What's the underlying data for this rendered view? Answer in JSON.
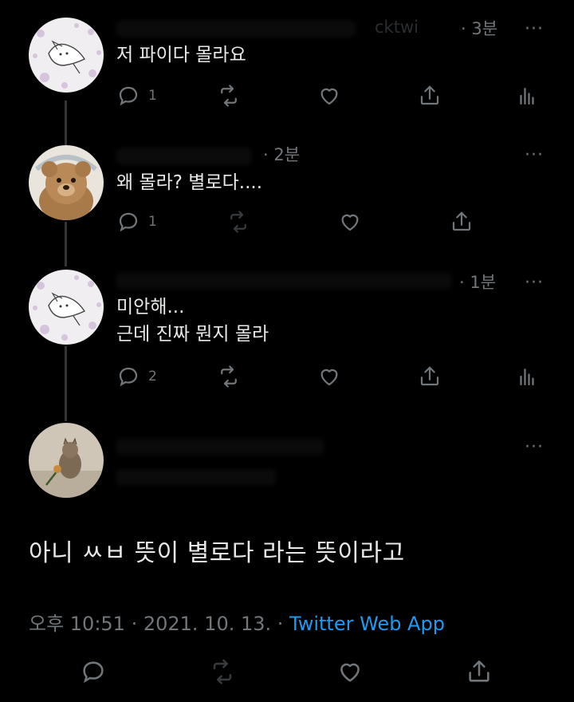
{
  "thread": [
    {
      "time": "· 3분",
      "handle_fragment": "cktwi",
      "text": "저 파이다 몰라요",
      "reply_count": "1",
      "show_analytics": true
    },
    {
      "time": "· 2분",
      "handle_fragment": "",
      "text": "왜 몰라? 별로다....",
      "reply_count": "1",
      "show_analytics": false
    },
    {
      "time": "· 1분",
      "handle_fragment": "",
      "text": "미안해...\n근데 진짜 뭔지 몰라",
      "reply_count": "2",
      "show_analytics": true
    }
  ],
  "main_tweet": {
    "text": "아니 ㅆㅂ 뜻이 별로다 라는 뜻이라고",
    "time": "오후 10:51 · 2021. 10. 13. · ",
    "source": "Twitter Web App"
  },
  "more_label": "···",
  "colors": {
    "background": "#000000",
    "text": "#e7e9ea",
    "muted": "#71767b",
    "link": "#1d9bf0"
  }
}
